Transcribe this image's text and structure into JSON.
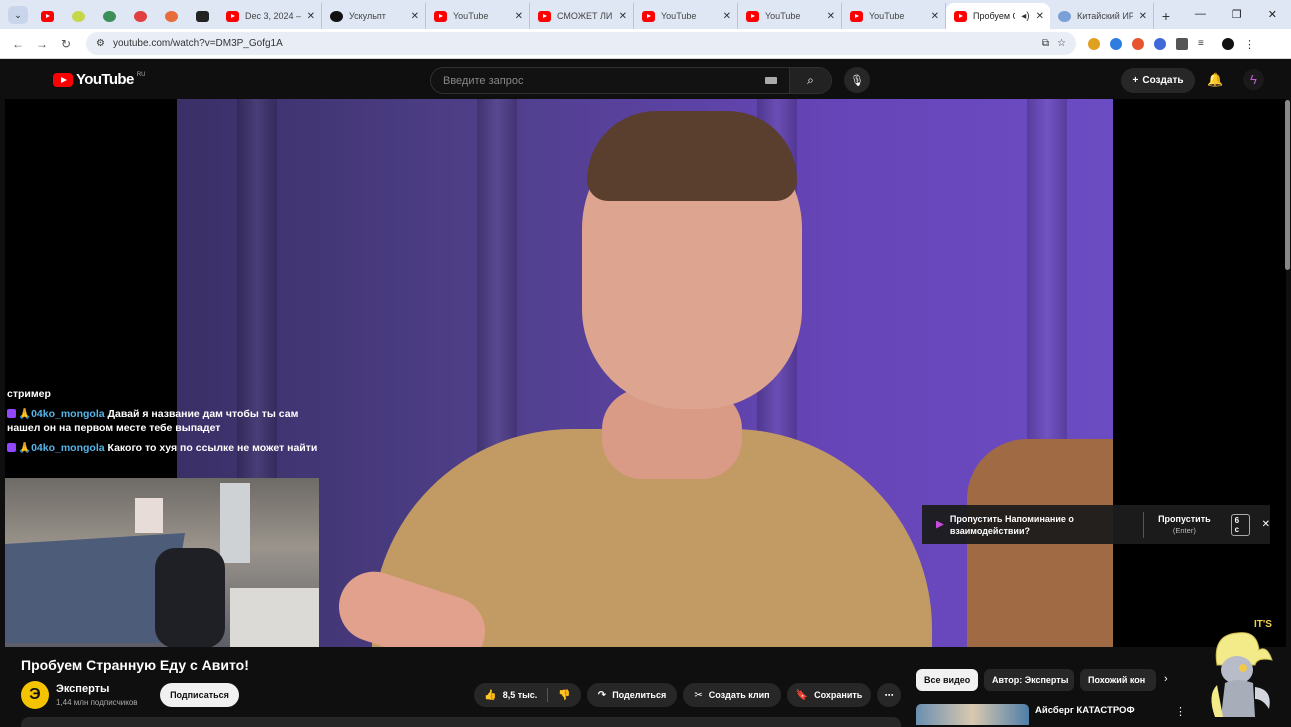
{
  "tabs": [
    {
      "label": "Dec 3, 2024 – …",
      "icon": "doc"
    },
    {
      "label": "Ускульпт",
      "icon": "ucscout"
    },
    {
      "label": "YouTube",
      "icon": "youtube"
    },
    {
      "label": "СМОЖЕТ ЛИ …",
      "icon": "youtube"
    },
    {
      "label": "YouTube",
      "icon": "youtube"
    },
    {
      "label": "YouTube",
      "icon": "youtube"
    },
    {
      "label": "YouTube",
      "icon": "youtube"
    },
    {
      "label": "Пробуем С",
      "icon": "youtube",
      "active": true
    },
    {
      "label": "Китайский ИРО…",
      "icon": "web"
    }
  ],
  "address": {
    "url": "youtube.com/watch?v=DM3P_Gofg1A"
  },
  "youtube": {
    "logo_text": "YouTube",
    "country": "RU",
    "search_placeholder": "Введите запрос",
    "create_label": "Создать"
  },
  "chat": {
    "top_line": "стример",
    "messages": [
      {
        "user": "04ko_mongola",
        "text": "Давай я название дам чтобы ты сам нашел он на первом месте тебе выпадет"
      },
      {
        "user": "04ko_mongola",
        "text": "Какого то хуя по ссылке не может найти"
      }
    ]
  },
  "overlay": {
    "corner_text": "IT'S"
  },
  "skip_prompt": {
    "text": "Пропустить Напоминание о взаимодействии?",
    "action": "Пропустить",
    "action_hint": "(Enter)",
    "key": "6 с"
  },
  "video": {
    "title": "Пробуем Странную Еду с Авито!",
    "channel_initial": "Э",
    "channel": "Эксперты",
    "subscribers": "1,44 млн подписчиков",
    "subscribe_label": "Подписаться",
    "likes": "8,5 тыс.",
    "share_label": "Поделиться",
    "clip_label": "Создать клип",
    "save_label": "Сохранить"
  },
  "chips": [
    "Все видео",
    "Автор: Эксперты",
    "Похожий кон"
  ],
  "recommendation": {
    "title": "Айсберг КАТАСТРОФ"
  },
  "colors": {
    "accent": "#ff0000",
    "twitch": "#9146ff",
    "chat_name": "#56b5e8"
  }
}
